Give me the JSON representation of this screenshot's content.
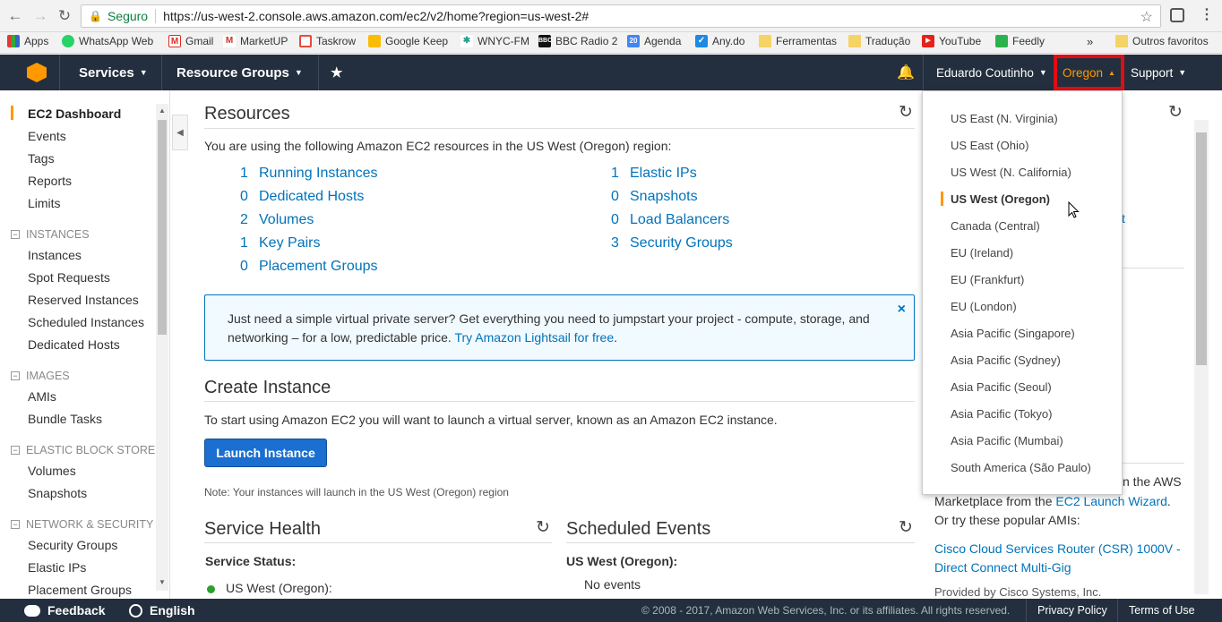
{
  "browser": {
    "secure_label": "Seguro",
    "url": "https://us-west-2.console.aws.amazon.com/ec2/v2/home?region=us-west-2#",
    "bookmarks": [
      "Apps",
      "WhatsApp Web",
      "Gmail",
      "MarketUP",
      "Taskrow",
      "Google Keep",
      "WNYC-FM",
      "BBC Radio 2",
      "Agenda",
      "Any.do",
      "Ferramentas",
      "Tradução",
      "YouTube",
      "Feedly"
    ],
    "bookmarks_overflow": "»",
    "other_bookmarks": "Outros favoritos",
    "agenda_badge": "20"
  },
  "header": {
    "services": "Services",
    "resource_groups": "Resource Groups",
    "user": "Eduardo Coutinho",
    "region": "Oregon",
    "support": "Support"
  },
  "sidebar": {
    "top_items": [
      "EC2 Dashboard",
      "Events",
      "Tags",
      "Reports",
      "Limits"
    ],
    "sections": [
      {
        "title": "INSTANCES",
        "items": [
          "Instances",
          "Spot Requests",
          "Reserved Instances",
          "Scheduled Instances",
          "Dedicated Hosts"
        ]
      },
      {
        "title": "IMAGES",
        "items": [
          "AMIs",
          "Bundle Tasks"
        ]
      },
      {
        "title": "ELASTIC BLOCK STORE",
        "items": [
          "Volumes",
          "Snapshots"
        ]
      },
      {
        "title": "NETWORK & SECURITY",
        "items": [
          "Security Groups",
          "Elastic IPs",
          "Placement Groups"
        ]
      }
    ]
  },
  "resources": {
    "title": "Resources",
    "intro": "You are using the following Amazon EC2 resources in the US West (Oregon) region:",
    "left": [
      {
        "count": "1",
        "label": "Running Instances"
      },
      {
        "count": "0",
        "label": "Dedicated Hosts"
      },
      {
        "count": "2",
        "label": "Volumes"
      },
      {
        "count": "1",
        "label": "Key Pairs"
      },
      {
        "count": "0",
        "label": "Placement Groups"
      }
    ],
    "right": [
      {
        "count": "1",
        "label": "Elastic IPs"
      },
      {
        "count": "0",
        "label": "Snapshots"
      },
      {
        "count": "0",
        "label": "Load Balancers"
      },
      {
        "count": "3",
        "label": "Security Groups"
      }
    ]
  },
  "promo": {
    "text": "Just need a simple virtual private server? Get everything you need to jumpstart your project - compute, storage, and networking – for a low, predictable price.",
    "link": "Try Amazon Lightsail for free",
    "close": "×"
  },
  "create_instance": {
    "title": "Create Instance",
    "text": "To start using Amazon EC2 you will want to launch a virtual server, known as an Amazon EC2 instance.",
    "button": "Launch Instance",
    "note": "Note: Your instances will launch in the US West (Oregon) region"
  },
  "service_health": {
    "title": "Service Health",
    "status_label": "Service Status:",
    "status_value": "US West (Oregon):"
  },
  "scheduled_events": {
    "title": "Scheduled Events",
    "region_label": "US West (Oregon):",
    "value": "No events"
  },
  "regions": {
    "items": [
      "US East (N. Virginia)",
      "US East (Ohio)",
      "US West (N. California)",
      "US West (Oregon)",
      "Canada (Central)",
      "EU (Ireland)",
      "EU (Frankfurt)",
      "EU (London)",
      "Asia Pacific (Singapore)",
      "Asia Pacific (Sydney)",
      "Asia Pacific (Seoul)",
      "Asia Pacific (Tokyo)",
      "Asia Pacific (Mumbai)",
      "South America (São Paulo)"
    ],
    "selected": "US West (Oregon)"
  },
  "right_panel": {
    "frag_top": "t",
    "frag_aws": "n the AWS",
    "marketplace_text": "Marketplace from the",
    "wizard_link": "EC2 Launch Wizard",
    "popular": "Or try these popular AMIs:",
    "ami_link": "Cisco Cloud Services Router (CSR) 1000V - Direct Connect Multi-Gig",
    "provided": "Provided by Cisco Systems, Inc."
  },
  "footer": {
    "feedback": "Feedback",
    "language": "English",
    "copyright": "© 2008 - 2017, Amazon Web Services, Inc. or its affiliates. All rights reserved.",
    "privacy": "Privacy Policy",
    "terms": "Terms of Use"
  }
}
